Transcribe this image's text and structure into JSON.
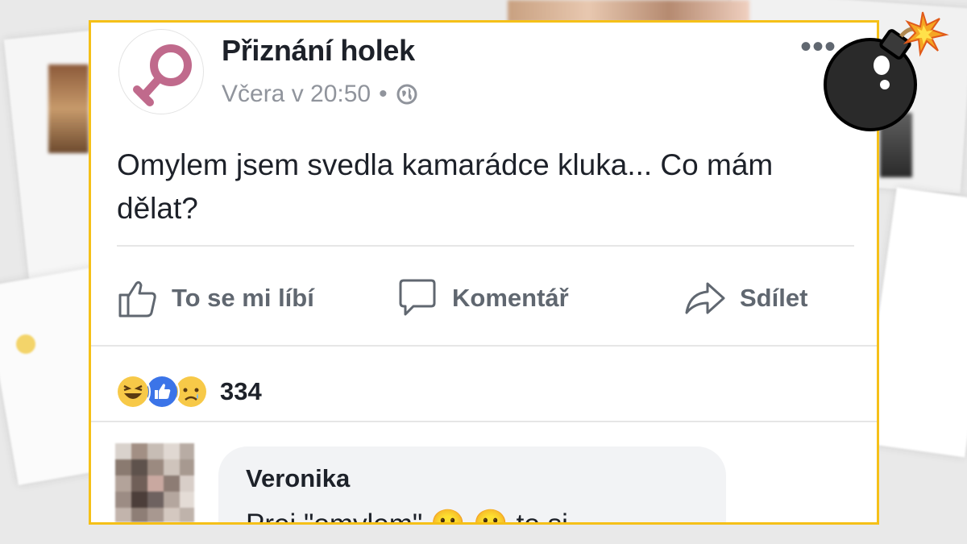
{
  "post": {
    "page_name": "Přiznání holek",
    "timestamp": "Včera v 20:50",
    "separator": "•",
    "privacy_icon": "globe-icon",
    "more_label": "•••",
    "text": "Omylem jsem svedla kamarádce kluka... Co mám dělat?"
  },
  "actions": {
    "like": "To se mi líbí",
    "comment": "Komentář",
    "share": "Sdílet"
  },
  "reactions": {
    "icons": [
      "haha-icon",
      "like-icon",
      "sad-icon"
    ],
    "count": "334"
  },
  "comment": {
    "author": "Veronika",
    "text": "Prej \"omylem\" 😀 😀 to si..."
  },
  "colors": {
    "frame": "#f5c018",
    "logo": "#c06a8c",
    "like_blue": "#3b74e8"
  },
  "decoration": {
    "bomb_icon": "bomb-icon"
  }
}
